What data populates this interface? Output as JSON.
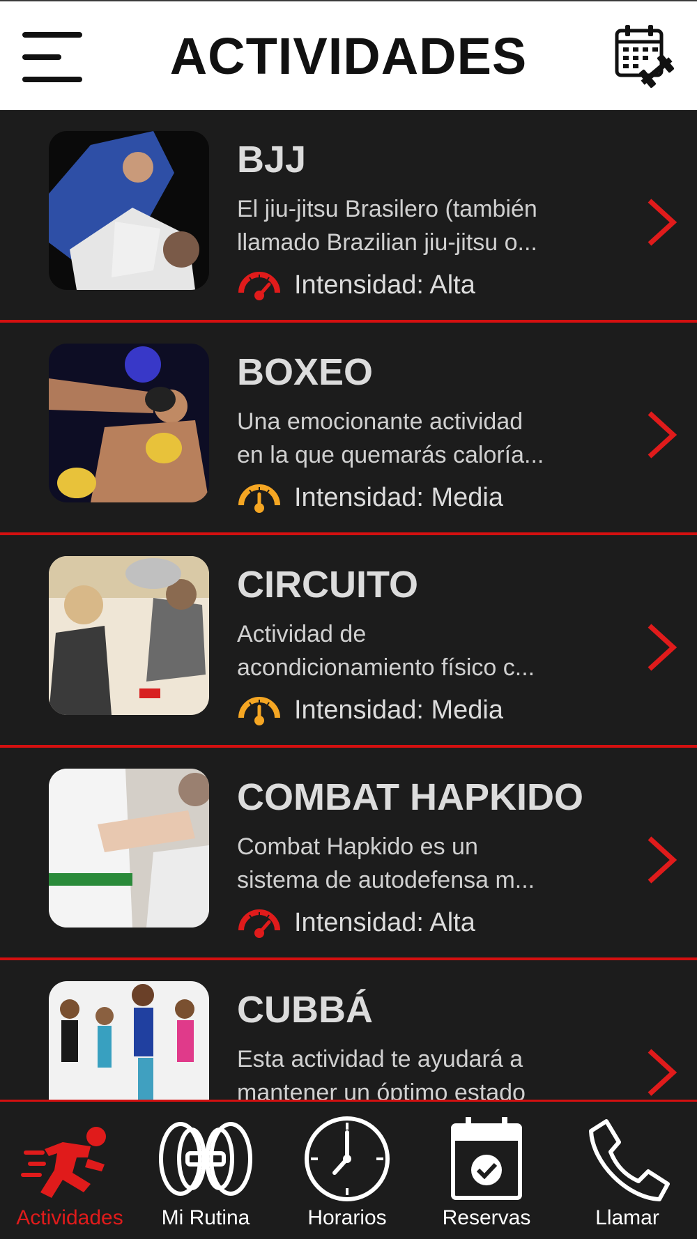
{
  "header": {
    "title": "ACTIVIDADES",
    "menu_icon": "hamburger-menu-icon",
    "calendar_icon": "calendar-dumbbell-icon"
  },
  "colors": {
    "accent": "#d31010",
    "background": "#1c1c1c",
    "intensity_high": "#e01b1b",
    "intensity_medium": "#f5a623"
  },
  "activities": [
    {
      "title": "BJJ",
      "desc_line1": "El jiu-jitsu Brasilero (también",
      "desc_line2": "llamado Brazilian jiu-jitsu o...",
      "intensity": "Intensidad: Alta",
      "level": "high"
    },
    {
      "title": "BOXEO",
      "desc_line1": "Una emocionante actividad",
      "desc_line2": "en la que quemarás caloría...",
      "intensity": "Intensidad: Media",
      "level": "medium"
    },
    {
      "title": "CIRCUITO",
      "desc_line1": "Actividad de",
      "desc_line2": "acondicionamiento físico c...",
      "intensity": "Intensidad: Media",
      "level": "medium"
    },
    {
      "title": "COMBAT HAPKIDO",
      "desc_line1": "Combat Hapkido es un",
      "desc_line2": "sistema de autodefensa m...",
      "intensity": "Intensidad: Alta",
      "level": "high"
    },
    {
      "title": "CUBBÁ",
      "desc_line1": "Esta actividad te ayudará a",
      "desc_line2": "mantener un óptimo estado"
    }
  ],
  "nav": [
    {
      "label": "Actividades",
      "icon": "running-person-icon",
      "active": true
    },
    {
      "label": "Mi Rutina",
      "icon": "weight-plates-icon",
      "active": false
    },
    {
      "label": "Horarios",
      "icon": "clock-icon",
      "active": false
    },
    {
      "label": "Reservas",
      "icon": "calendar-check-icon",
      "active": false
    },
    {
      "label": "Llamar",
      "icon": "phone-icon",
      "active": false
    }
  ]
}
